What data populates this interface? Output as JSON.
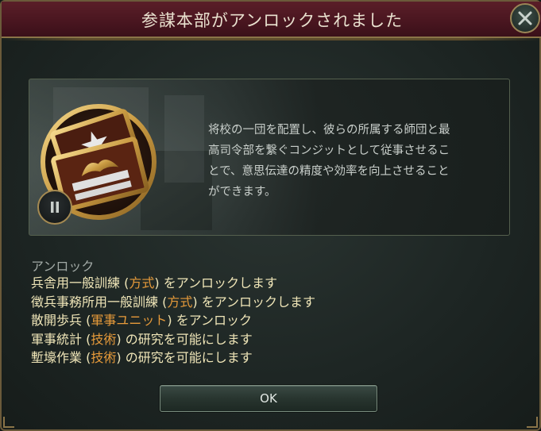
{
  "dialog": {
    "title": "参謀本部がアンロックされました",
    "close_icon": "close-icon"
  },
  "banner": {
    "emblem_icon": "staff-insignia-emblem",
    "pause_icon": "pause-icon",
    "description": "将校の一団を配置し、彼らの所属する師団と最\n高司令部を繋ぐコンジットとして従事させるこ\nとで、意思伝達の精度や効率を向上させること\nができます。"
  },
  "unlocks": {
    "header": "アンロック",
    "items": [
      {
        "pre": "兵舎用一般訓練 (",
        "accent": "方式",
        "post": ") をアンロックします"
      },
      {
        "pre": "徴兵事務所用一般訓練 (",
        "accent": "方式",
        "post": ") をアンロックします"
      },
      {
        "pre": "散開歩兵 (",
        "accent": "軍事ユニット",
        "post": ") をアンロック"
      },
      {
        "pre": "軍事統計 (",
        "accent": "技術",
        "post": ") の研究を可能にします"
      },
      {
        "pre": "塹壕作業 (",
        "accent": "技術",
        "post": ") の研究を可能にします"
      }
    ]
  },
  "ok_button": {
    "label": "OK"
  },
  "colors": {
    "title_bar": "#4a1620",
    "accent_text": "#e69a3a",
    "item_text": "#f0e6b8",
    "gold_border": "#8a7448"
  }
}
